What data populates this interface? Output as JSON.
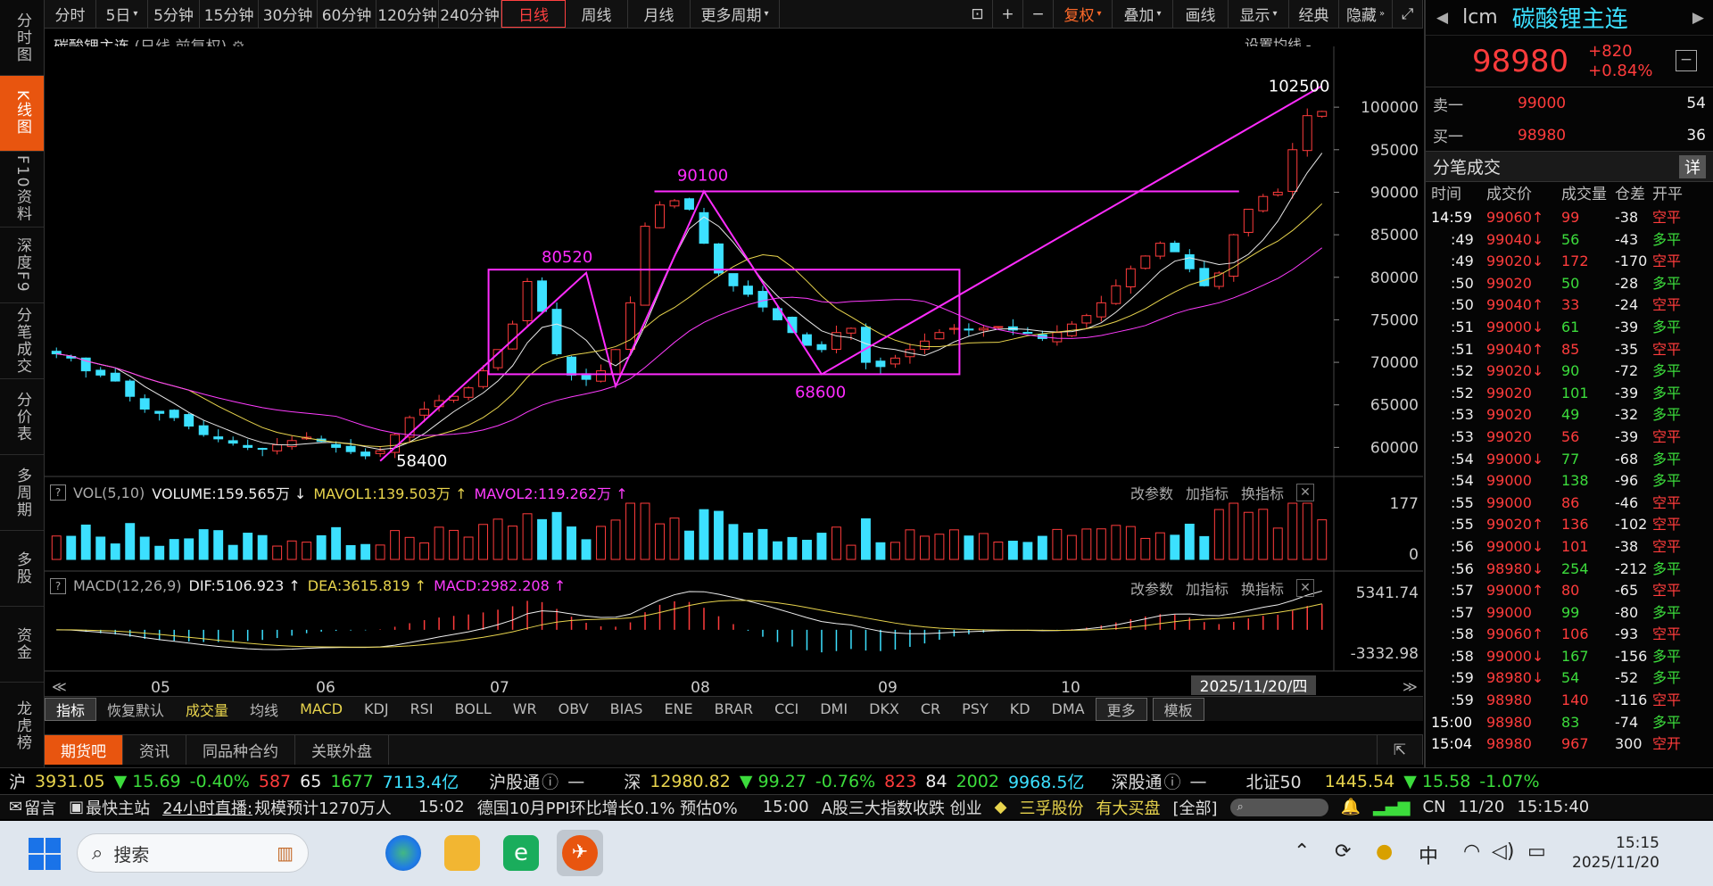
{
  "sidebar": [
    {
      "label": "分时图",
      "active": false
    },
    {
      "label": "K线图",
      "active": true
    },
    {
      "label": "F10资料",
      "active": false
    },
    {
      "label": "深度F9",
      "active": false
    },
    {
      "label": "分笔成交",
      "active": false
    },
    {
      "label": "分价表",
      "active": false
    },
    {
      "label": "多周期",
      "active": false
    },
    {
      "label": "多股",
      "active": false
    },
    {
      "label": "资金",
      "active": false
    },
    {
      "label": "龙虎榜",
      "active": false
    }
  ],
  "toolbar": {
    "periods": [
      "分时",
      "5日",
      "5分钟",
      "15分钟",
      "30分钟",
      "60分钟",
      "120分钟",
      "240分钟",
      "日线",
      "周线",
      "月线",
      "更多周期"
    ],
    "active_period": "日线",
    "tools": [
      "复权",
      "叠加",
      "画线",
      "显示",
      "经典",
      "隐藏"
    ]
  },
  "chart_title": {
    "name": "碳酸锂主连",
    "sub": "(日线,前复权)"
  },
  "set_ma": "设置均线",
  "chart_data": [
    {
      "type": "candlestick",
      "title": "碳酸锂主连",
      "ylim": [
        57000,
        104000
      ],
      "y_ticks": [
        60000,
        65000,
        70000,
        75000,
        80000,
        85000,
        90000,
        95000,
        100000
      ],
      "x_ticks": [
        "05",
        "06",
        "07",
        "08",
        "09",
        "10"
      ],
      "annotations": [
        "102500",
        "90100",
        "80520",
        "68600",
        "58400"
      ],
      "date_label": "2025/11/20/四",
      "approx_close_path": [
        71000,
        70500,
        69000,
        68500,
        67800,
        66000,
        64500,
        64000,
        63500,
        62500,
        61500,
        61000,
        60500,
        60000,
        59800,
        60300,
        60800,
        61200,
        60700,
        60000,
        59500,
        59000,
        59600,
        61500,
        63500,
        64500,
        65500,
        66000,
        67000,
        69000,
        71500,
        74500,
        79500,
        76000,
        71000,
        68500,
        68000,
        69000,
        71500,
        77000,
        86000,
        88500,
        89000,
        88000,
        84000,
        80500,
        79000,
        78000,
        76500,
        75000,
        73500,
        72000,
        71500,
        73500,
        74000,
        70000,
        69500,
        70500,
        71500,
        72500,
        73500,
        74000,
        73800,
        74000,
        74200,
        73800,
        73500,
        72800,
        73500,
        74500,
        75500,
        77000,
        79000,
        81000,
        82500,
        84000,
        83000,
        81000,
        79000,
        80500,
        85000,
        88000,
        89500,
        90000,
        95000,
        99000,
        99500
      ],
      "drawn_lines": "trend lines and rectangle boxes in magenta"
    },
    {
      "type": "bar",
      "title": "VOL(5,10)",
      "series": [
        {
          "name": "VOLUME",
          "value": "159.565万"
        },
        {
          "name": "MAVOL1",
          "value": "139.503万"
        },
        {
          "name": "MAVOL2",
          "value": "119.262万"
        }
      ],
      "ylim": [
        0,
        177
      ],
      "y_ticks": [
        0,
        177
      ]
    },
    {
      "type": "line",
      "title": "MACD(12,26,9)",
      "series": [
        {
          "name": "DIF",
          "value": "5106.923"
        },
        {
          "name": "DEA",
          "value": "3615.819"
        },
        {
          "name": "MACD",
          "value": "2982.208"
        }
      ],
      "ylim": [
        -3332.98,
        5341.74
      ],
      "y_ticks": [
        5341.74,
        -3332.98
      ]
    }
  ],
  "vol_legend": {
    "label": "VOL(5,10)",
    "volume": "VOLUME:159.565万",
    "mavol1": "MAVOL1:139.503万",
    "mavol2": "MAVOL2:119.262万"
  },
  "macd_legend": {
    "label": "MACD(12,26,9)",
    "dif": "DIF:5106.923",
    "dea": "DEA:3615.819",
    "macd": "MACD:2982.208"
  },
  "panel_buttons": [
    "改参数",
    "加指标",
    "换指标"
  ],
  "indicators": [
    "指标",
    "恢复默认",
    "成交量",
    "均线",
    "MACD",
    "KDJ",
    "RSI",
    "BOLL",
    "WR",
    "OBV",
    "BIAS",
    "ENE",
    "BRAR",
    "CCI",
    "DMI",
    "DKX",
    "CR",
    "PSY",
    "KD",
    "DMA",
    "更多",
    "模板"
  ],
  "bottom_tabs": [
    "期货吧",
    "资讯",
    "同品种合约",
    "关联外盘"
  ],
  "quote": {
    "code": "lcm",
    "name": "碳酸锂主连",
    "price": "98980",
    "change": "+820",
    "pct": "+0.84%",
    "sell_label": "卖一",
    "sell_price": "99000",
    "sell_vol": "54",
    "buy_label": "买一",
    "buy_price": "98980",
    "buy_vol": "36",
    "ticks_title": "分笔成交",
    "ticks_detail": "详",
    "ticks_headers": [
      "时间",
      "成交价",
      "成交量",
      "仓差",
      "开平"
    ],
    "ticks": [
      [
        "14:59",
        "99060↑",
        "99",
        "-38",
        "空平",
        "r"
      ],
      [
        ":49",
        "99040↓",
        "56",
        "-43",
        "多平",
        "g"
      ],
      [
        ":49",
        "99020↓",
        "172",
        "-170",
        "空平",
        "r"
      ],
      [
        ":50",
        "99020",
        "50",
        "-28",
        "多平",
        "g"
      ],
      [
        ":50",
        "99040↑",
        "33",
        "-24",
        "空平",
        "r"
      ],
      [
        ":51",
        "99000↓",
        "61",
        "-39",
        "多平",
        "g"
      ],
      [
        ":51",
        "99040↑",
        "85",
        "-35",
        "空平",
        "r"
      ],
      [
        ":52",
        "99020↓",
        "90",
        "-72",
        "多平",
        "g"
      ],
      [
        ":52",
        "99020",
        "101",
        "-39",
        "多平",
        "g"
      ],
      [
        ":53",
        "99020",
        "49",
        "-32",
        "多平",
        "g"
      ],
      [
        ":53",
        "99020",
        "56",
        "-39",
        "空平",
        "r"
      ],
      [
        ":54",
        "99000↓",
        "77",
        "-68",
        "多平",
        "g"
      ],
      [
        ":54",
        "99000",
        "138",
        "-96",
        "多平",
        "g"
      ],
      [
        ":55",
        "99000",
        "86",
        "-46",
        "空平",
        "r"
      ],
      [
        ":55",
        "99020↑",
        "136",
        "-102",
        "空平",
        "r"
      ],
      [
        ":56",
        "99000↓",
        "101",
        "-38",
        "空平",
        "r"
      ],
      [
        ":56",
        "98980↓",
        "254",
        "-212",
        "多平",
        "g"
      ],
      [
        ":57",
        "99000↑",
        "80",
        "-65",
        "空平",
        "r"
      ],
      [
        ":57",
        "99000",
        "99",
        "-80",
        "多平",
        "g"
      ],
      [
        ":58",
        "99060↑",
        "106",
        "-93",
        "空平",
        "r"
      ],
      [
        ":58",
        "99000↓",
        "167",
        "-156",
        "多平",
        "g"
      ],
      [
        ":59",
        "98980↓",
        "54",
        "-52",
        "多平",
        "g"
      ],
      [
        ":59",
        "98980",
        "140",
        "-116",
        "空平",
        "r"
      ],
      [
        "15:00",
        "98980",
        "83",
        "-74",
        "多平",
        "g"
      ],
      [
        "15:04",
        "98980",
        "967",
        "300",
        "空开",
        "r"
      ]
    ]
  },
  "index_bar": {
    "sh_label": "沪",
    "sh": "3931.05",
    "sh_chg": "▼ 15.69",
    "sh_pct": "-0.40%",
    "sh_up": "587",
    "sh_flat": "65",
    "sh_down": "1677",
    "sh_amt": "7113.4亿",
    "hgt": "沪股通",
    "hgt_val": "—",
    "sz_label": "深",
    "sz": "12980.82",
    "sz_chg": "▼ 99.27",
    "sz_pct": "-0.76%",
    "sz_up": "823",
    "sz_flat": "84",
    "sz_down": "2002",
    "sz_amt": "9968.5亿",
    "sgt": "深股通",
    "sgt_val": "—",
    "bz_label": "北证50",
    "bz": "1445.54",
    "bz_chg": "▼ 15.58",
    "bz_pct": "-1.07%"
  },
  "news_bar": {
    "msg": "留言",
    "site": "最快主站",
    "live": "24小时直播:",
    "live_text": "规模预计1270万人",
    "t1": "15:02",
    "n1": "德国10月PPI环比增长0.1% 预估0%",
    "t2": "15:00",
    "n2": "A股三大指数收跌 创业",
    "stock": "三孚股份",
    "stock_note": "有大买盘",
    "all": "[全部]",
    "lang": "CN",
    "date": "11/20",
    "time": "15:15:40"
  },
  "taskbar": {
    "search_placeholder": "搜索",
    "ime": "中",
    "time": "15:15",
    "date": "2025/11/20"
  }
}
